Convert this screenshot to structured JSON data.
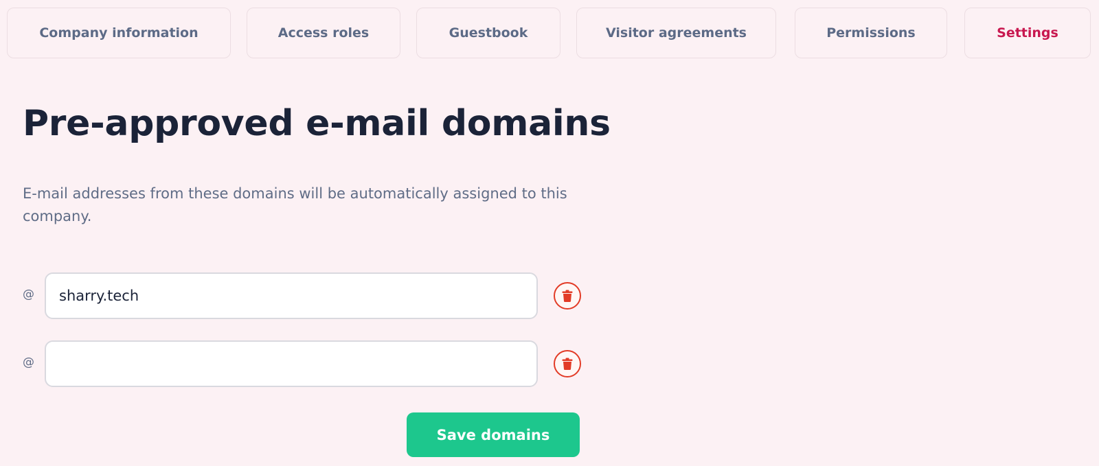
{
  "tabs": [
    {
      "label": "Company information",
      "active": false
    },
    {
      "label": "Access roles",
      "active": false
    },
    {
      "label": "Guestbook",
      "active": false
    },
    {
      "label": "Visitor agreements",
      "active": false
    },
    {
      "label": "Permissions",
      "active": false
    },
    {
      "label": "Settings",
      "active": true
    }
  ],
  "section": {
    "title": "Pre-approved e-mail domains",
    "description": "E-mail addresses from these domains will be automatically assigned to this company."
  },
  "domains": [
    {
      "prefix": "@",
      "value": "sharry.tech",
      "placeholder": "",
      "delete_icon": "trash-icon"
    },
    {
      "prefix": "@",
      "value": "",
      "placeholder": "",
      "delete_icon": "trash-icon"
    }
  ],
  "save_button": {
    "label": "Save domains"
  },
  "colors": {
    "background": "#fcf1f4",
    "active_tab": "#c8174f",
    "tab_text": "#5c6a86",
    "delete_accent": "#e23b26",
    "save_button": "#1dc78d"
  }
}
